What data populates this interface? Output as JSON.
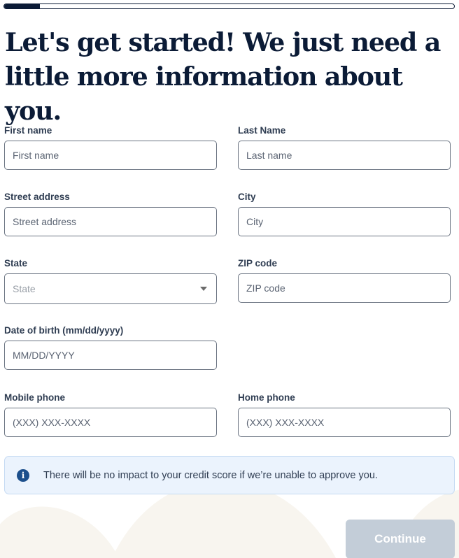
{
  "progress": {
    "percent": 8,
    "fill_color": "#0b1b36"
  },
  "heading": "Let's get started! We just need a little more information about you.",
  "form": {
    "first_name": {
      "label": "First name",
      "placeholder": "First name",
      "value": ""
    },
    "last_name": {
      "label": "Last Name",
      "placeholder": "Last name",
      "value": ""
    },
    "street_address": {
      "label": "Street address",
      "placeholder": "Street address",
      "value": ""
    },
    "city": {
      "label": "City",
      "placeholder": "City",
      "value": ""
    },
    "state": {
      "label": "State",
      "placeholder": "State",
      "selected": ""
    },
    "zip": {
      "label": "ZIP code",
      "placeholder": "ZIP code",
      "value": ""
    },
    "dob": {
      "label": "Date of birth (mm/dd/yyyy)",
      "placeholder": "MM/DD/YYYY",
      "value": ""
    },
    "mobile_phone": {
      "label": "Mobile phone",
      "placeholder": "(XXX) XXX-XXXX",
      "value": ""
    },
    "home_phone": {
      "label": "Home phone",
      "placeholder": "(XXX) XXX-XXXX",
      "value": ""
    }
  },
  "info_banner": {
    "icon": "info-icon",
    "glyph": "i",
    "text": "There will be no impact to your credit score if we’re unable to approve you."
  },
  "continue_button": {
    "label": "Continue",
    "disabled": true
  },
  "colors": {
    "primary": "#0b1b36",
    "info_bg": "#ebf3fd",
    "info_icon": "#1c4f8c",
    "button_disabled": "#c3cdd8",
    "decor_shape": "#f8f5ef"
  }
}
